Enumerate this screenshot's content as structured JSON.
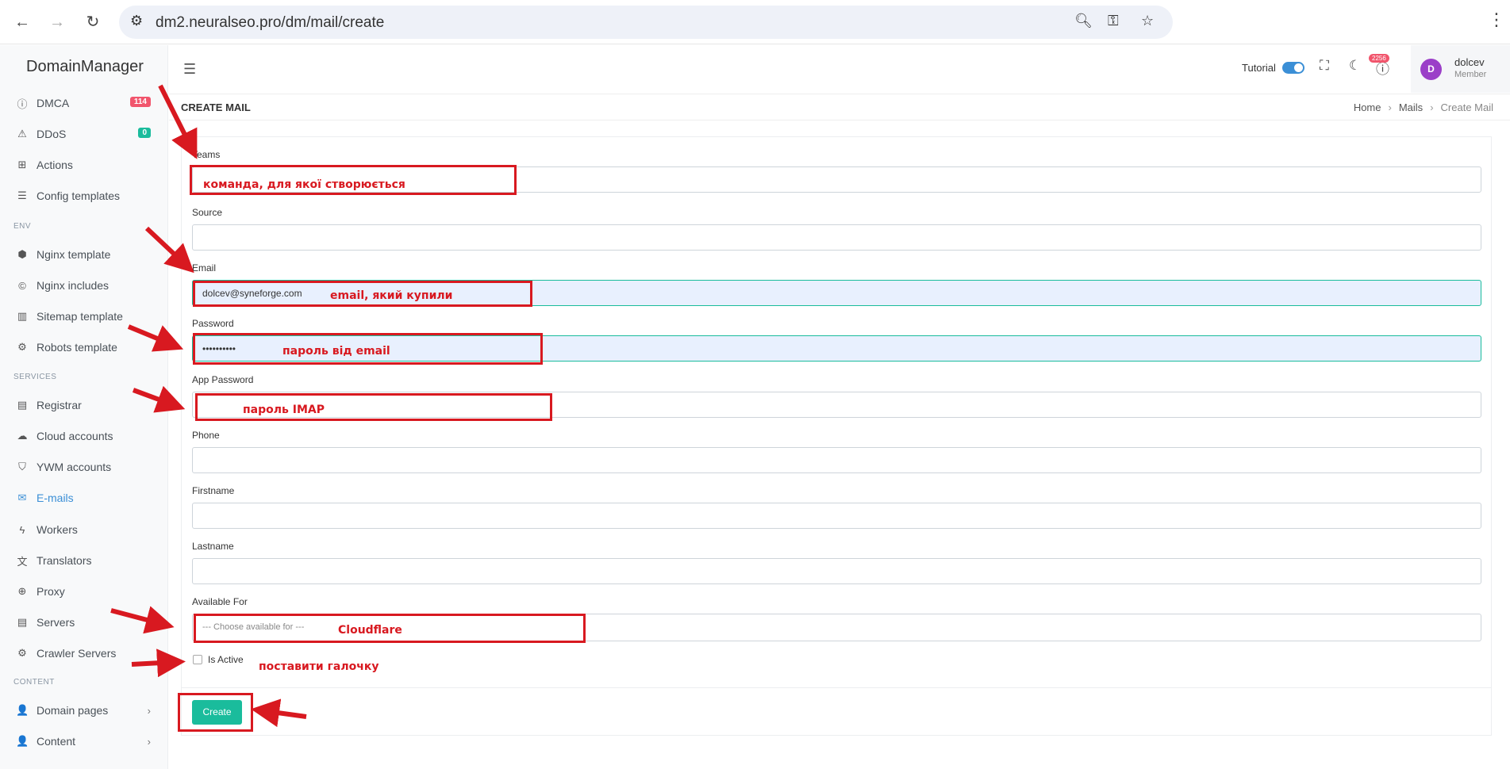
{
  "browser": {
    "url": "dm2.neuralseo.pro/dm/mail/create",
    "back_icon": "←",
    "forward_icon": "→",
    "reload_icon": "↻"
  },
  "sidebar": {
    "brand": "DomainManager",
    "items": [
      {
        "label": "DMCA",
        "icon": "ⓘ",
        "badge": "114"
      },
      {
        "label": "DDoS",
        "icon": "⚠",
        "badge": "0"
      },
      {
        "label": "Actions",
        "icon": "⊞"
      },
      {
        "label": "Config templates",
        "icon": "☰"
      },
      {
        "label": "Nginx template",
        "icon": "⬢"
      },
      {
        "label": "Nginx includes",
        "icon": "©"
      },
      {
        "label": "Sitemap template",
        "icon": "▥"
      },
      {
        "label": "Robots template",
        "icon": "⚙"
      },
      {
        "label": "Registrar",
        "icon": "▤"
      },
      {
        "label": "Cloud accounts",
        "icon": "☁"
      },
      {
        "label": "YWM accounts",
        "icon": "⛉"
      },
      {
        "label": "E-mails",
        "icon": "✉"
      },
      {
        "label": "Workers",
        "icon": "ϟ"
      },
      {
        "label": "Translators",
        "icon": "文"
      },
      {
        "label": "Proxy",
        "icon": "⊕"
      },
      {
        "label": "Servers",
        "icon": "▤"
      },
      {
        "label": "Crawler Servers",
        "icon": "⚙"
      },
      {
        "label": "Domain pages",
        "icon": "👤"
      },
      {
        "label": "Content",
        "icon": "👤"
      }
    ],
    "sections": {
      "env": "ENV",
      "services": "SERVICES",
      "content": "CONTENT"
    }
  },
  "topbar": {
    "tutorial_label": "Tutorial",
    "notif_count": "2256",
    "user": {
      "initial": "D",
      "name": "dolcev",
      "role": "Member"
    }
  },
  "page": {
    "title": "CREATE MAIL",
    "breadcrumb": [
      "Home",
      "Mails",
      "Create Mail"
    ]
  },
  "form": {
    "teams_label": "Teams",
    "source_label": "Source",
    "email_label": "Email",
    "email_value": "dolcev@syneforge.com",
    "password_label": "Password",
    "password_value": "••••••••••",
    "app_password_label": "App Password",
    "phone_label": "Phone",
    "firstname_label": "Firstname",
    "lastname_label": "Lastname",
    "available_for_label": "Available For",
    "available_for_placeholder": "--- Choose available for ---",
    "is_active_label": "Is Active",
    "create_label": "Create"
  },
  "annotations": {
    "teams": "команда, для якої створюється",
    "email": "email, який купили",
    "password": "пароль від email",
    "app_password": "пароль IMAP",
    "available_for": "Cloudflare",
    "is_active": "поставити галочку"
  },
  "colors": {
    "accent": "#1abc9c",
    "link": "#3b8fd6",
    "annotation": "#d81920"
  }
}
